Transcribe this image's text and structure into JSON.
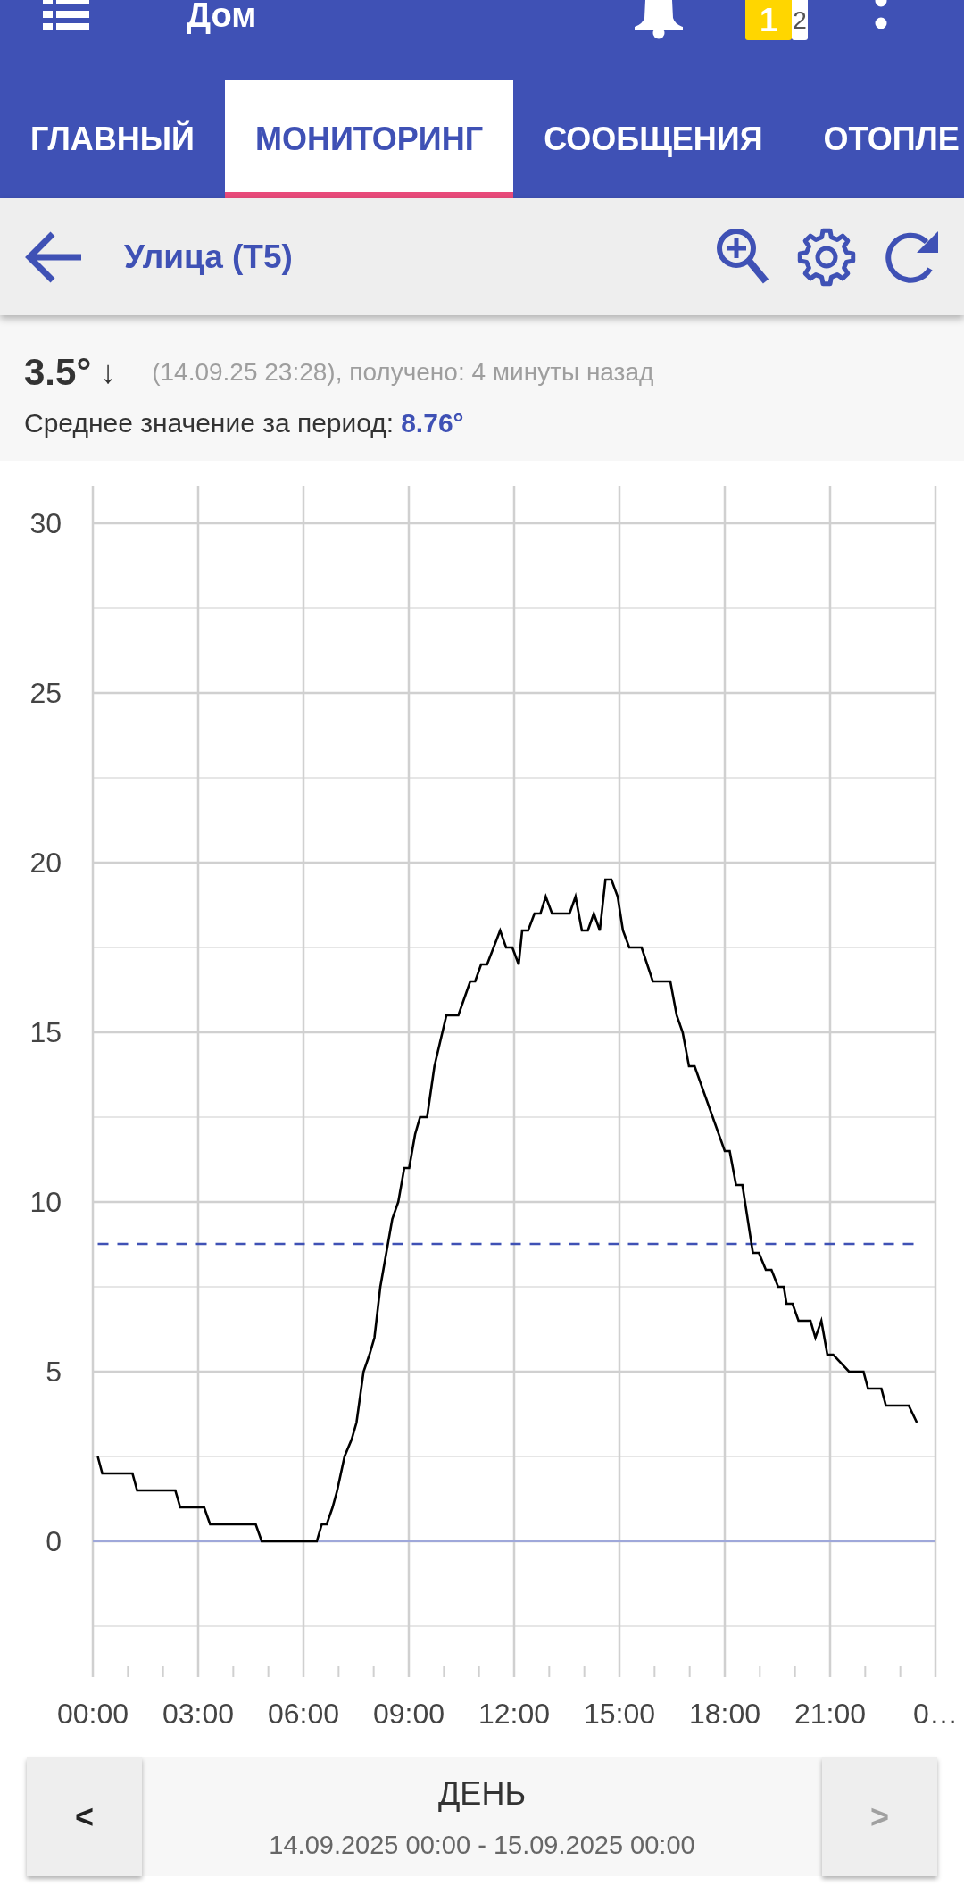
{
  "toolbar": {
    "title": "Дом",
    "badges": [
      {
        "text": "1",
        "color": "#ffd600"
      },
      {
        "text": "2",
        "color": "#ffffff"
      }
    ]
  },
  "tabs": [
    {
      "label": "ГЛАВНЫЙ",
      "selected": false
    },
    {
      "label": "МОНИТОРИНГ",
      "selected": true
    },
    {
      "label": "СООБЩЕНИЯ",
      "selected": false
    },
    {
      "label": "ОТОПЛЕ",
      "selected": false
    }
  ],
  "sensor_bar": {
    "title": "Улица (T5)"
  },
  "reading": {
    "value": "3.5°",
    "trend": "↓",
    "timestamp": "(14.09.25 23:28), получено: 4 минуты назад",
    "average_label": "Среднее значение за период:",
    "average_value": "8.76°"
  },
  "chart": {
    "chart_data": {
      "type": "line",
      "grid": true,
      "x": [
        0.14,
        0.27,
        1.13,
        1.26,
        2.35,
        2.49,
        3.17,
        3.34,
        4.64,
        4.81,
        6.38,
        6.52,
        6.66,
        6.83,
        6.96,
        7.17,
        7.37,
        7.51,
        7.71,
        7.88,
        8.02,
        8.19,
        8.36,
        8.53,
        8.7,
        8.87,
        9.01,
        9.18,
        9.32,
        9.52,
        9.73,
        10.07,
        10.41,
        10.75,
        10.89,
        11.06,
        11.23,
        11.6,
        11.77,
        11.95,
        12.13,
        12.23,
        12.4,
        12.58,
        12.75,
        12.9,
        13.08,
        13.58,
        13.75,
        13.93,
        14.1,
        14.27,
        14.44,
        14.6,
        14.77,
        14.95,
        15.1,
        15.28,
        15.63,
        15.95,
        16.45,
        16.63,
        16.8,
        16.98,
        17.14,
        18.0,
        18.14,
        18.32,
        18.5,
        18.8,
        18.97,
        19.17,
        19.33,
        19.52,
        19.68,
        19.76,
        19.93,
        20.1,
        20.44,
        20.58,
        20.75,
        20.92,
        21.09,
        21.54,
        21.95,
        22.08,
        22.46,
        22.59,
        23.24,
        23.47
      ],
      "xlim": [
        0,
        24
      ],
      "ylim": [
        -4,
        31
      ],
      "xticks": [
        {
          "value": 0,
          "label": "00:00"
        },
        {
          "value": 3,
          "label": "03:00"
        },
        {
          "value": 6,
          "label": "06:00"
        },
        {
          "value": 9,
          "label": "09:00"
        },
        {
          "value": 12,
          "label": "12:00"
        },
        {
          "value": 15,
          "label": "15:00"
        },
        {
          "value": 18,
          "label": "18:00"
        },
        {
          "value": 21,
          "label": "21:00"
        },
        {
          "value": 24,
          "label": "0…"
        }
      ],
      "yticks": [
        0,
        5,
        10,
        15,
        20,
        25,
        30
      ],
      "series": [
        {
          "color": "#000000",
          "values": [
            2.5,
            2,
            2,
            1.5,
            1.5,
            1,
            1,
            0.5,
            0.5,
            0,
            0,
            0.5,
            0.5,
            1,
            1.5,
            2.5,
            3,
            3.5,
            5,
            5.5,
            6,
            7.5,
            8.5,
            9.5,
            10,
            11,
            11,
            12,
            12.5,
            12.5,
            14,
            15.5,
            15.5,
            16.5,
            16.5,
            17,
            17,
            18,
            17.5,
            17.5,
            17,
            18,
            18,
            18.5,
            18.5,
            19,
            18.5,
            18.5,
            19,
            18,
            18,
            18.5,
            18,
            19.5,
            19.5,
            19,
            18,
            17.5,
            17.5,
            16.5,
            16.5,
            15.5,
            15,
            14,
            14,
            11.5,
            11.5,
            10.5,
            10.5,
            8.5,
            8.5,
            8,
            8,
            7.5,
            7.5,
            7,
            7,
            6.5,
            6.5,
            6,
            6.5,
            5.5,
            5.5,
            5,
            5,
            4.5,
            4.5,
            4,
            4,
            3.5
          ]
        }
      ],
      "ref_lines": [
        {
          "axis": "y",
          "value": 8.76,
          "color": "#3f51b5"
        },
        {
          "axis": "y",
          "value": 0,
          "color": "#9fa8da"
        }
      ]
    }
  },
  "period_nav": {
    "prev": {
      "label": "<",
      "disabled": false
    },
    "title": "ДЕНЬ",
    "range": "14.09.2025 00:00 - 15.09.2025 00:00",
    "next": {
      "label": ">",
      "disabled": true
    }
  }
}
